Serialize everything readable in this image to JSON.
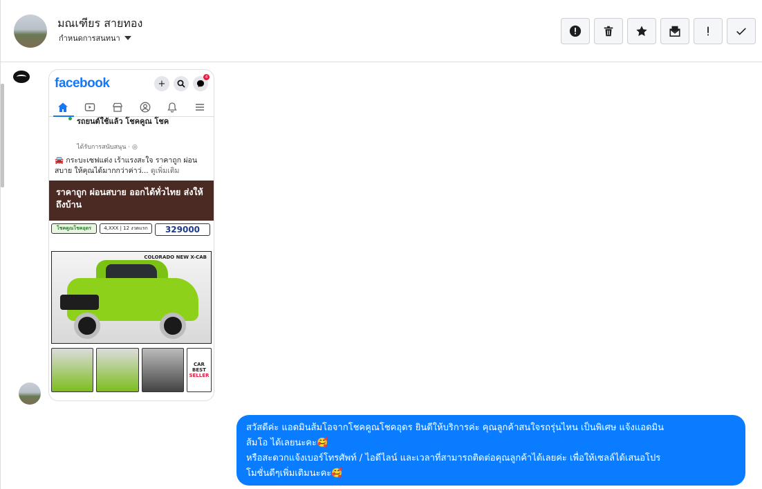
{
  "header": {
    "contact_name": "มณเฑียร สายทอง",
    "subtitle": "กำหนดการสนทนา",
    "actions": [
      {
        "name": "report",
        "icon": "alert-circle-icon"
      },
      {
        "name": "delete",
        "icon": "trash-icon"
      },
      {
        "name": "star",
        "icon": "star-icon"
      },
      {
        "name": "mark-unread",
        "icon": "envelope-icon"
      },
      {
        "name": "important",
        "icon": "exclamation-icon"
      },
      {
        "name": "done",
        "icon": "checkmark-icon"
      }
    ]
  },
  "shared_image": {
    "app_name": "facebook",
    "badge_count": "4",
    "post_title": "รถยนต์ใช้แล้ว โชคคูณ โชค",
    "sponsored": "ได้รับการสนับสนุน · ",
    "post_text": "🚘 กระบะเซฟแต่ง เร้าแรงสะใจ ราคาถูก ผ่อนสบาย ให้คุณได้มากกว่าค่าว่...",
    "see_more": "ดูเพิ่มเติม",
    "banner": "ราคาถูก ผ่อนสบาย ออกได้ทั่วไทย ส่งให้ถึงบ้าน",
    "ad_label": "โชคคูณโชคอุดร",
    "monthly": "4,XXX | 12 งวดแรก",
    "price": "329000",
    "model": "COLORADO NEW X-CAB",
    "badge_text": [
      "CAR",
      "BEST",
      "SELLER"
    ]
  },
  "message": {
    "line1": "สวัสดีค่ะ แอดมินส้มโอจากโชคคูณโชคอุดร ยินดีให้บริการค่ะ   คุณลูกค้าสนใจรถรุ่นไหน เป็นพิเศษ แจ้งแอดมิน",
    "line2": "ส้มโอ ได้เลยนะคะ🥰",
    "line3": "หรือสะดวกแจ้งเบอร์โทรศัพท์ / ไอดีไลน์ และเวลาที่สามารถติดต่อคุณลูกค้าได้เลยค่ะ เพื่อให้เซลล์ได้เสนอโปร",
    "line4": "โมชั่นดีๆเพิ่มเติมนะคะ🥰"
  }
}
